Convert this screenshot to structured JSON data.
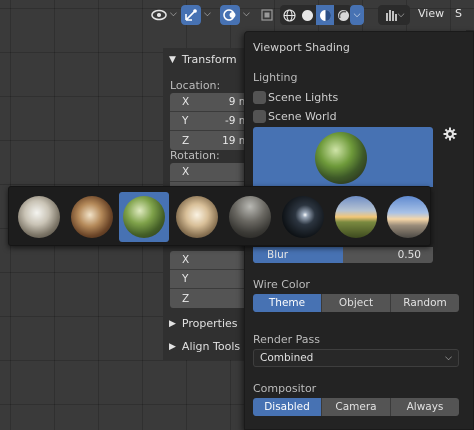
{
  "header": {
    "view_menu": "View"
  },
  "transform_panel": {
    "title": "Transform",
    "location_label": "Location:",
    "location": [
      {
        "axis": "X",
        "value": "9 m"
      },
      {
        "axis": "Y",
        "value": "-9 m"
      },
      {
        "axis": "Z",
        "value": "19 m"
      }
    ],
    "rotation_label": "Rotation:",
    "rotation_visible": [
      {
        "axis": "X"
      },
      {
        "axis": "Y"
      }
    ],
    "scale_visible": [
      {
        "axis": "X"
      },
      {
        "axis": "Y"
      },
      {
        "axis": "Z"
      }
    ],
    "properties_label": "Properties",
    "align_tools_label": "Align Tools"
  },
  "shading_popup": {
    "title": "Viewport Shading",
    "lighting_label": "Lighting",
    "scene_lights": "Scene Lights",
    "scene_world": "Scene World",
    "blur_label": "Blur",
    "blur_value": "0.50",
    "blur_fraction": 0.5,
    "wire_color_label": "Wire Color",
    "wire_color_options": [
      "Theme",
      "Object",
      "Random"
    ],
    "render_pass_label": "Render Pass",
    "render_pass_value": "Combined",
    "compositor_label": "Compositor",
    "compositor_options": [
      "Disabled",
      "Camera",
      "Always"
    ]
  },
  "hdri_picker": {
    "selected_index": 2,
    "count": 8
  },
  "colors": {
    "accent": "#4772b3",
    "panel": "#303030",
    "popup": "#232323",
    "field": "#545454"
  }
}
